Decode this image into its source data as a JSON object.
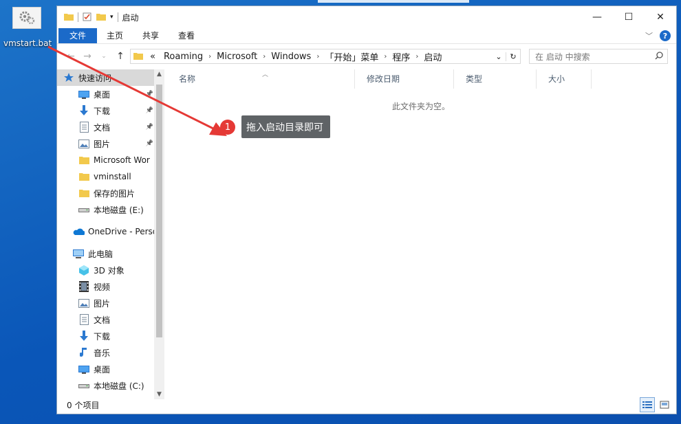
{
  "desktop": {
    "icon_label": "vmstart.bat",
    "icon_name": "gear-file-icon"
  },
  "window": {
    "title": "启动",
    "controls": {
      "minimize": "—",
      "maximize": "☐",
      "close": "✕"
    }
  },
  "ribbon": {
    "tabs": [
      "文件",
      "主页",
      "共享",
      "查看"
    ],
    "help": "?"
  },
  "address": {
    "prefix": "«",
    "crumbs": [
      "Roaming",
      "Microsoft",
      "Windows",
      "「开始」菜单",
      "程序",
      "启动"
    ]
  },
  "search": {
    "placeholder": "在 启动 中搜索"
  },
  "nav": {
    "quick_access": "快速访问",
    "quick_items": [
      {
        "label": "桌面",
        "icon": "desktop-icon",
        "pinned": true
      },
      {
        "label": "下载",
        "icon": "download-icon",
        "pinned": true
      },
      {
        "label": "文档",
        "icon": "document-icon",
        "pinned": true
      },
      {
        "label": "图片",
        "icon": "picture-icon",
        "pinned": true
      },
      {
        "label": "Microsoft Wor",
        "icon": "folder-icon",
        "pinned": false
      },
      {
        "label": "vminstall",
        "icon": "folder-icon",
        "pinned": false
      },
      {
        "label": "保存的图片",
        "icon": "folder-icon",
        "pinned": false
      },
      {
        "label": "本地磁盘 (E:)",
        "icon": "drive-icon",
        "pinned": false
      }
    ],
    "onedrive": "OneDrive - Perso",
    "this_pc": "此电脑",
    "pc_items": [
      {
        "label": "3D 对象",
        "icon": "3d-objects-icon"
      },
      {
        "label": "视频",
        "icon": "video-icon"
      },
      {
        "label": "图片",
        "icon": "picture-icon"
      },
      {
        "label": "文档",
        "icon": "document-icon"
      },
      {
        "label": "下载",
        "icon": "download-icon"
      },
      {
        "label": "音乐",
        "icon": "music-icon"
      },
      {
        "label": "桌面",
        "icon": "desktop-icon"
      },
      {
        "label": "本地磁盘 (C:)",
        "icon": "drive-icon"
      }
    ]
  },
  "columns": [
    "名称",
    "修改日期",
    "类型",
    "大小"
  ],
  "empty_message": "此文件夹为空。",
  "status": "0 个项目",
  "annotation": {
    "number": "1",
    "text": "拖入启动目录即可",
    "color": "#e53935"
  }
}
